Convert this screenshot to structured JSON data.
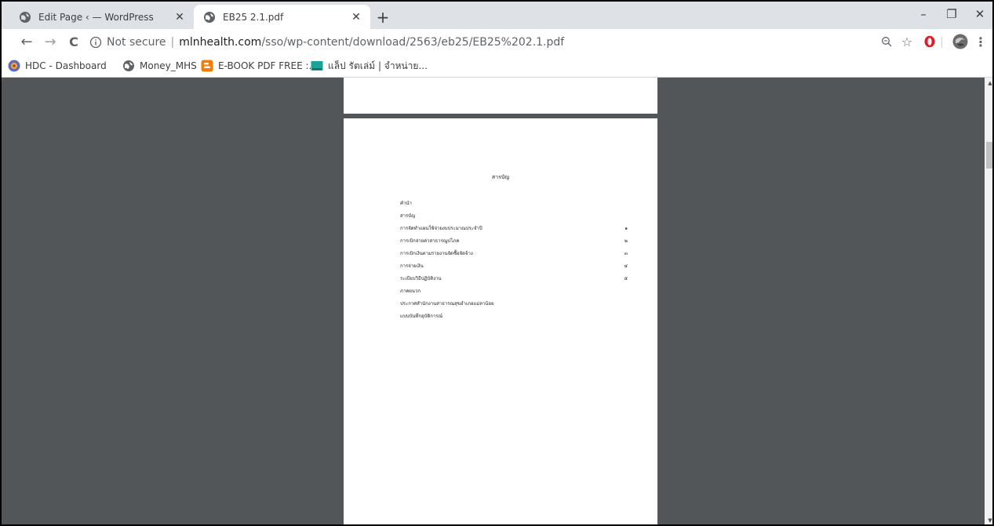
{
  "tabs": [
    {
      "title": "Edit Page ‹ — WordPress",
      "active": false
    },
    {
      "title": "EB25 2.1.pdf",
      "active": true
    }
  ],
  "new_tab_label": "+",
  "window_controls": {
    "minimize": "–",
    "restore": "❐",
    "close": "✕"
  },
  "toolbar": {
    "back": "←",
    "forward": "→",
    "reload": "C",
    "security_label": "Not secure",
    "separator": "|",
    "url_host": "mlnhealth.com",
    "url_path": "/sso/wp-content/download/2563/eb25/EB25%202.1.pdf",
    "zoom_icon": "search-icon",
    "star": "☆",
    "menu": "⋮"
  },
  "bookmarks": [
    {
      "label": "HDC - Dashboard",
      "icon": "hdc-favicon"
    },
    {
      "label": "Money_MHS",
      "icon": "globe-icon"
    },
    {
      "label": "E-BOOK PDF FREE :...",
      "icon": "blogger-icon"
    },
    {
      "label": "แล็ป รัตเล่ม์ | จำหน่าย...",
      "icon": "shop-icon"
    }
  ],
  "pdf": {
    "toc_title": "สารบัญ",
    "toc": [
      {
        "label": "คำนำ",
        "page": ""
      },
      {
        "label": "สารบัญ",
        "page": ""
      },
      {
        "label": "การจัดทำแผนใช้จ่ายงบประมาณประจำปี",
        "page": "๑"
      },
      {
        "label": "การเบิกจ่ายค่าสาธารณูปโภค",
        "page": "๒"
      },
      {
        "label": "การเบิกเงินตามรายงานจัดซื้อจัดจ้าง",
        "page": "๓"
      },
      {
        "label": "การจ่ายเงิน",
        "page": "๔"
      },
      {
        "label": "ระเบียบวิธีปฏิบัติงาน",
        "page": "๕"
      },
      {
        "label": "ภาคผนวก",
        "page": ""
      },
      {
        "label": "ประกาศสำนักงานสาธารณสุขอำเภอแม่ลาน้อย",
        "page": ""
      },
      {
        "label": "แบบบันทึกอุบัติการณ์",
        "page": ""
      }
    ]
  },
  "colors": {
    "tabstrip": "#dee1e6",
    "viewer_bg": "#525659",
    "opera_red": "#e31b23",
    "blogger_orange": "#f57d00",
    "shop_teal": "#1aa39a"
  }
}
